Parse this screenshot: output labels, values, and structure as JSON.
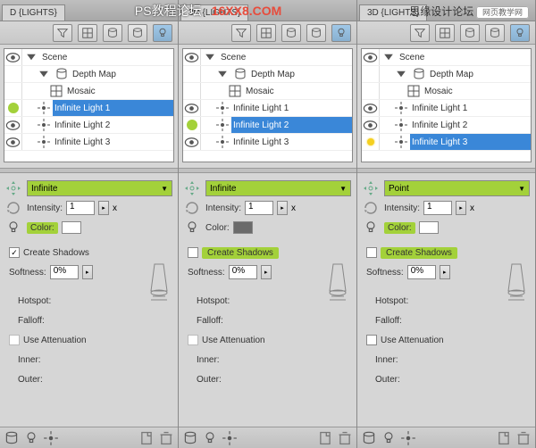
{
  "overlay": {
    "title_cn": "PS教程论坛",
    "watermark": "16XX8.COM",
    "right_text": "思缘设计论坛",
    "banner": "网页教学网"
  },
  "panels": [
    {
      "tab": "D {LIGHTS}",
      "scene": {
        "label": "Scene",
        "depth_map": "Depth Map",
        "mosaic": "Mosaic",
        "lights": [
          "Infinite Light 1",
          "Infinite Light 2",
          "Infinite Light 3"
        ],
        "selected_index": 0,
        "selected_marker": "green-dot"
      },
      "type": "Infinite",
      "type_highlight": true,
      "intensity_label": "Intensity:",
      "intensity": "1",
      "intensity_x": "x",
      "color_label": "Color:",
      "color": "#ffffff",
      "color_highlight": true,
      "create_shadows_label": "Create Shadows",
      "create_shadows_checked": true,
      "create_shadows_highlight": false,
      "softness_label": "Softness:",
      "softness": "0%",
      "hotspot": "Hotspot:",
      "falloff": "Falloff:",
      "use_attenuation": "Use Attenuation",
      "inner": "Inner:",
      "outer": "Outer:",
      "attenuation_enabled": false
    },
    {
      "tab": "3D {LIGHTS}",
      "scene": {
        "label": "Scene",
        "depth_map": "Depth Map",
        "mosaic": "Mosaic",
        "lights": [
          "Infinite Light 1",
          "Infinite Light 2",
          "Infinite Light 3"
        ],
        "selected_index": 1,
        "selected_marker": "green-dot"
      },
      "type": "Infinite",
      "type_highlight": true,
      "intensity_label": "Intensity:",
      "intensity": "1",
      "intensity_x": "x",
      "color_label": "Color:",
      "color": "#6b6b6b",
      "color_highlight": false,
      "create_shadows_label": "Create Shadows",
      "create_shadows_checked": false,
      "create_shadows_highlight": true,
      "softness_label": "Softness:",
      "softness": "0%",
      "hotspot": "Hotspot:",
      "falloff": "Falloff:",
      "use_attenuation": "Use Attenuation",
      "inner": "Inner:",
      "outer": "Outer:",
      "attenuation_enabled": false
    },
    {
      "tab": "3D {LIGHTS}",
      "scene": {
        "label": "Scene",
        "depth_map": "Depth Map",
        "mosaic": "Mosaic",
        "lights": [
          "Infinite Light 1",
          "Infinite Light 2",
          "Infinite Light 3"
        ],
        "selected_index": 2,
        "selected_marker": "yellow-spark"
      },
      "type": "Point",
      "type_highlight": true,
      "intensity_label": "Intensity:",
      "intensity": "1",
      "intensity_x": "x",
      "color_label": "Color:",
      "color": "#ffffff",
      "color_highlight": true,
      "create_shadows_label": "Create Shadows",
      "create_shadows_checked": false,
      "create_shadows_highlight": true,
      "softness_label": "Softness:",
      "softness": "0%",
      "hotspot": "Hotspot:",
      "falloff": "Falloff:",
      "use_attenuation": "Use Attenuation",
      "inner": "Inner:",
      "outer": "Outer:",
      "attenuation_enabled": true
    }
  ]
}
